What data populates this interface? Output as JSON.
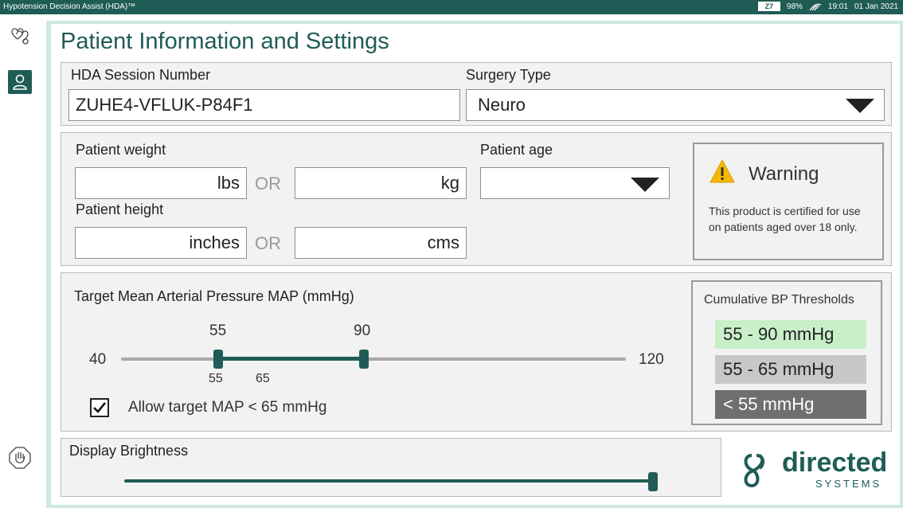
{
  "status_bar": {
    "app_title": "Hypotension Decision Assist (HDA)™",
    "battery_badge": "Z7",
    "battery": "98%",
    "time": "19:01",
    "date": "01 Jan 2021"
  },
  "page_title": "Patient Information and Settings",
  "session": {
    "session_label": "HDA Session Number",
    "session_value": "ZUHE4-VFLUK-P84F1",
    "surgery_label": "Surgery Type",
    "surgery_value": "Neuro"
  },
  "patient": {
    "weight_label": "Patient weight",
    "lbs_unit": "lbs",
    "kg_unit": "kg",
    "or_text": "OR",
    "age_label": "Patient age",
    "age_value": "",
    "height_label": "Patient height",
    "inches_unit": "inches",
    "cms_unit": "cms"
  },
  "warning": {
    "title": "Warning",
    "text": "This product is certified for use on patients aged over 18 only."
  },
  "target_map": {
    "label": "Target Mean Arterial Pressure MAP (mmHg)",
    "min": "40",
    "max": "120",
    "lower_value": "55",
    "upper_value": "90",
    "below_low": "55",
    "below_high": "65",
    "allow_label": "Allow target MAP < 65 mmHg",
    "allow_checked": true
  },
  "thresholds": {
    "title": "Cumulative BP Thresholds",
    "rows": [
      {
        "text": "55 - 90 mmHg",
        "color": "#c9efc9"
      },
      {
        "text": "55 - 65 mmHg",
        "color": "#c8c8c8"
      },
      {
        "text": "< 55 mmHg",
        "color": "#6f6f6f"
      }
    ]
  },
  "brightness": {
    "label": "Display Brightness",
    "level": 1.0
  },
  "logo": {
    "word": "directed",
    "sub": "SYSTEMS"
  },
  "colors": {
    "accent": "#1f5c55",
    "frame": "#cfe9e0",
    "warning": "#f5b800"
  }
}
